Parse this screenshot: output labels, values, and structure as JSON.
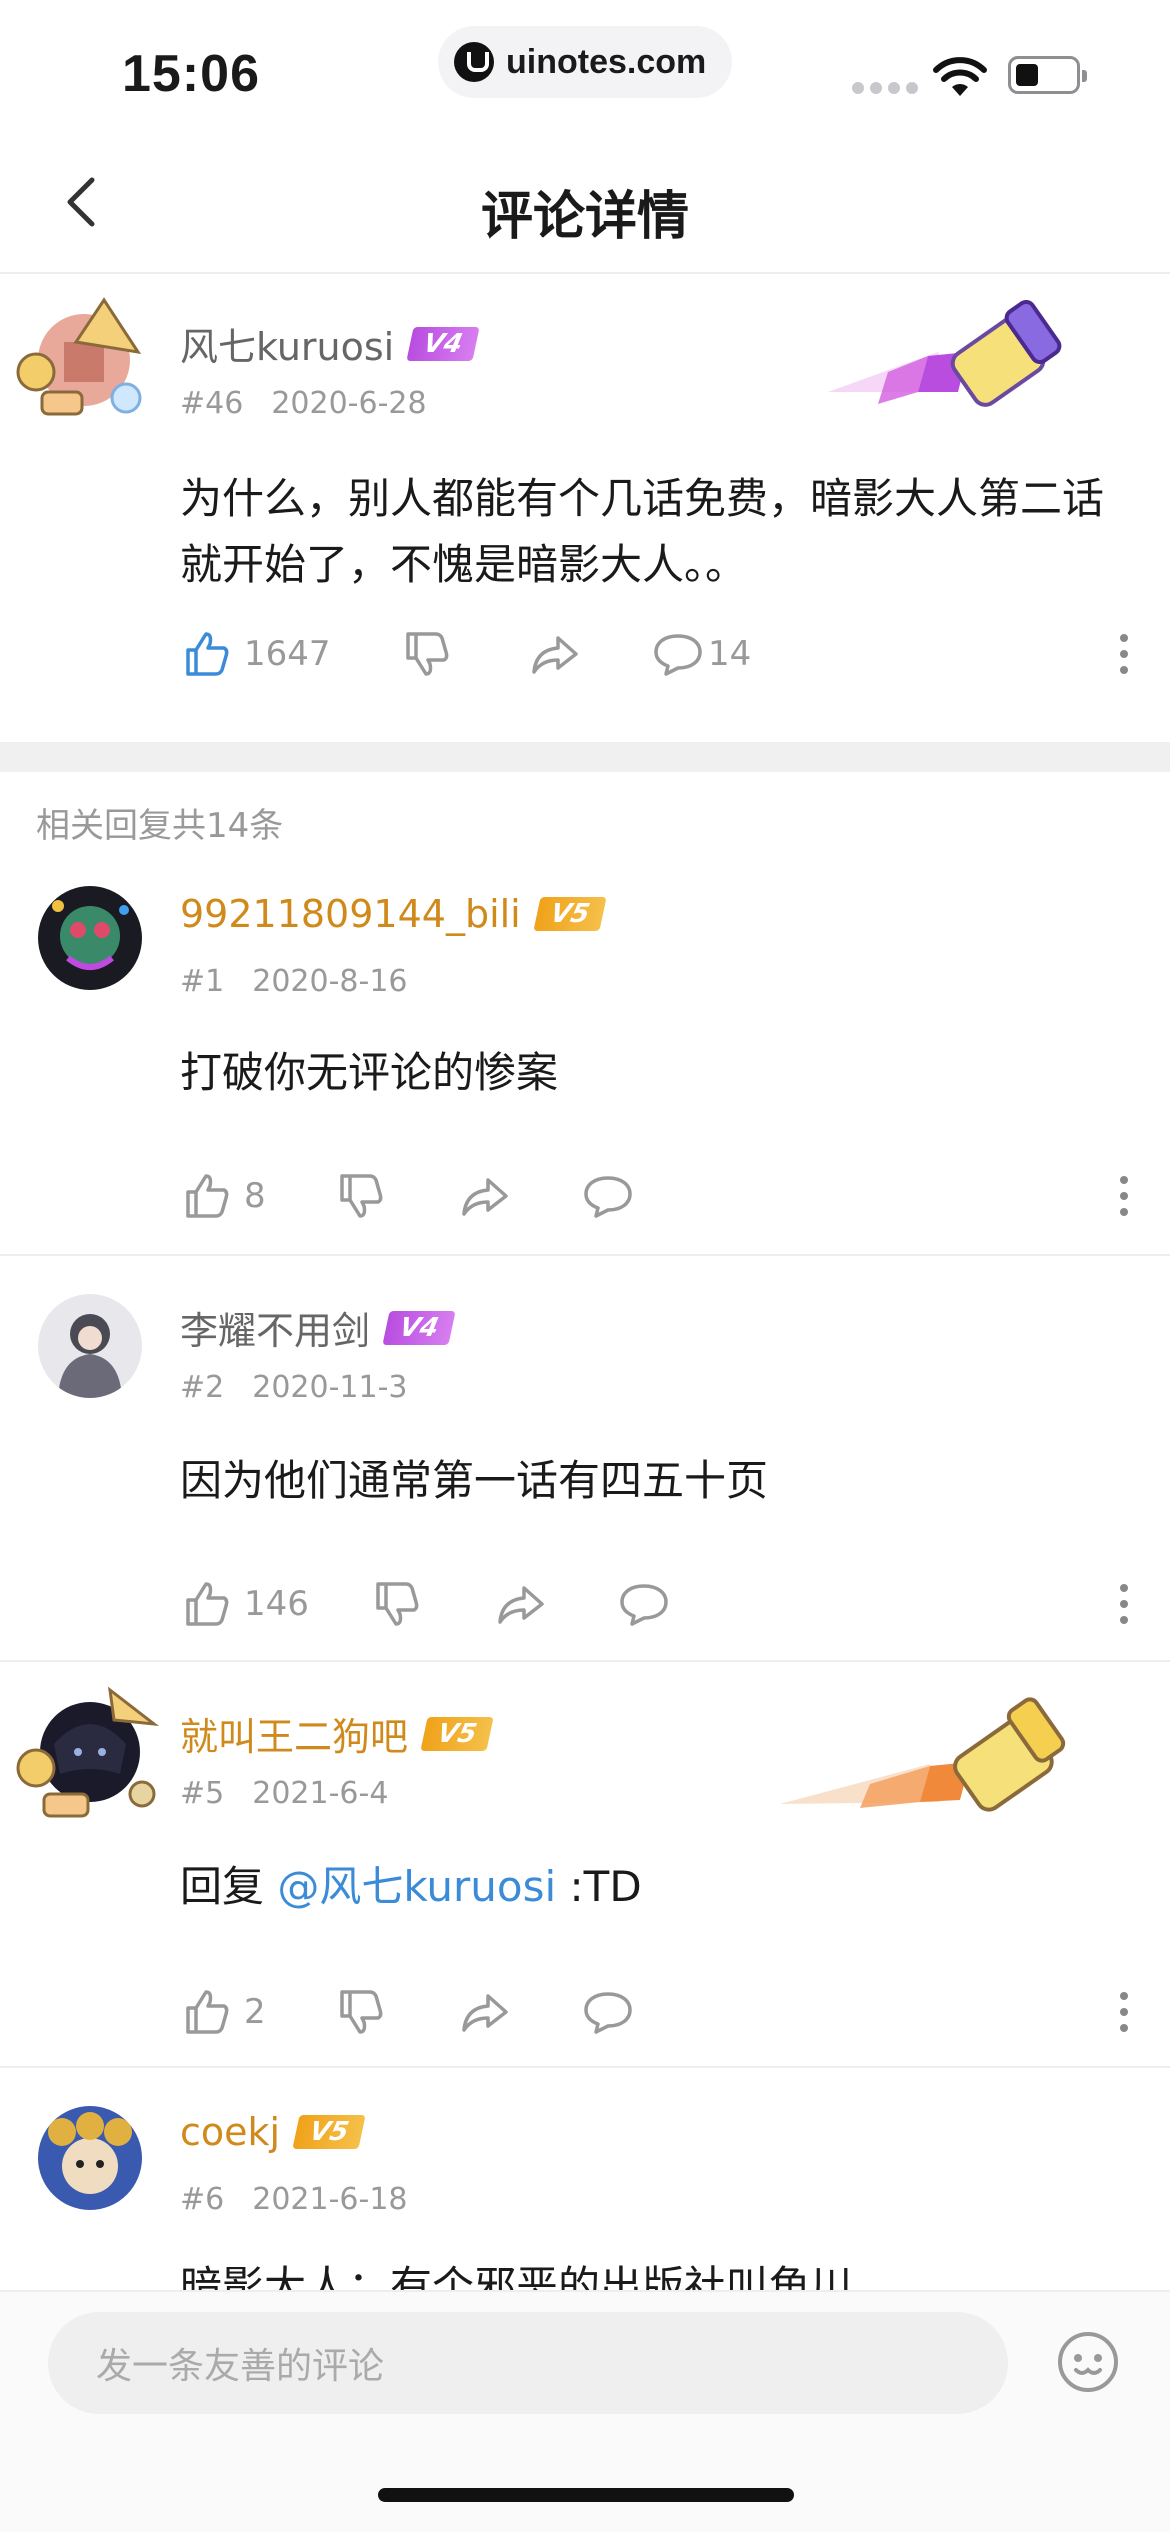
{
  "status_bar": {
    "time": "15:06",
    "url": "uinotes.com"
  },
  "nav": {
    "title": "评论详情"
  },
  "main_comment": {
    "username": "风七kuruosi",
    "level": "V4",
    "floor": "#46",
    "date": "2020-6-28",
    "text": "为什么，别人都能有个几话免费，暗影大人第二话就开始了，不愧是暗影大人。。",
    "likes": "1647",
    "replies": "14"
  },
  "reply_section": {
    "label": "相关回复共14条"
  },
  "replies": [
    {
      "username": "99211809144_bili",
      "level": "V5",
      "floor": "#1",
      "date": "2020-8-16",
      "text": "打破你无评论的惨案",
      "likes": "8"
    },
    {
      "username": "李耀不用剑",
      "level": "V4",
      "floor": "#2",
      "date": "2020-11-3",
      "text": "因为他们通常第一话有四五十页",
      "likes": "146"
    },
    {
      "username": "就叫王二狗吧",
      "level": "V5",
      "floor": "#5",
      "date": "2021-6-4",
      "text_prefix": "回复 ",
      "mention": "@风七kuruosi",
      "text_suffix": " :TD",
      "likes": "2"
    },
    {
      "username": "coekj",
      "level": "V5",
      "floor": "#6",
      "date": "2021-6-18",
      "text": "暗影大人：有个邪恶的出版社叫角川"
    }
  ],
  "composer": {
    "placeholder": "发一条友善的评论"
  },
  "icons": [
    "back-icon",
    "like-icon",
    "dislike-icon",
    "share-icon",
    "comment-icon",
    "more-icon",
    "emoji-icon",
    "wifi-icon",
    "battery-icon"
  ],
  "colors": {
    "gold_name": "#d08a1c",
    "mention": "#3b8bd8",
    "v4": "#b84de0",
    "v5": "#f0a21a",
    "like_active": "#3b8bd8"
  }
}
